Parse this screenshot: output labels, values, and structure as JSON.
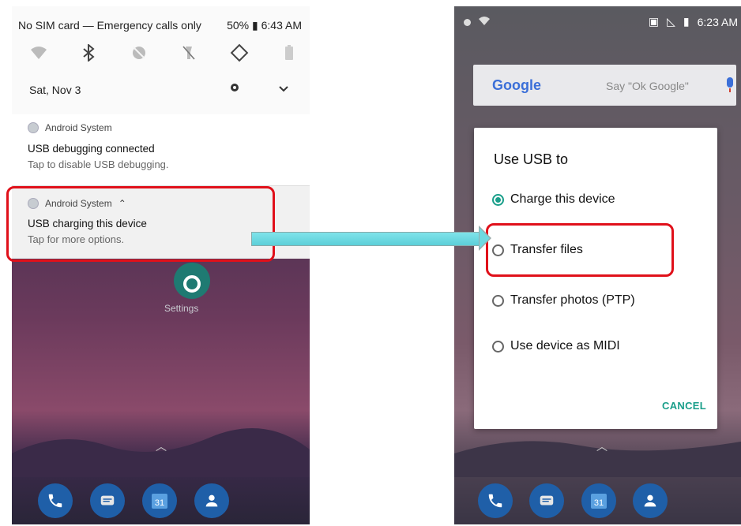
{
  "left_phone": {
    "status_text": "No SIM card — Emergency calls only",
    "battery": "50%",
    "time": "6:43 AM",
    "date": "Sat, Nov 3",
    "notification1": {
      "app": "Android System",
      "title": "USB debugging connected",
      "subtitle": "Tap to disable USB debugging."
    },
    "notification2": {
      "app": "Android System",
      "title": "USB charging this device",
      "subtitle": "Tap for more options."
    },
    "home_app_label": "Settings",
    "calendar_day": "31"
  },
  "right_phone": {
    "time": "6:23 AM",
    "search_brand": "Google",
    "search_hint": "Say \"Ok Google\"",
    "dialog": {
      "title": "Use USB to",
      "options": [
        {
          "label": "Charge this device",
          "selected": true
        },
        {
          "label": "Transfer files",
          "selected": false
        },
        {
          "label": "Transfer photos (PTP)",
          "selected": false
        },
        {
          "label": "Use device as MIDI",
          "selected": false
        }
      ],
      "cancel": "CANCEL"
    },
    "calendar_day": "31"
  },
  "colors": {
    "accent": "#199e8a",
    "highlight": "#e0101a",
    "arrow": "#6fd9e1"
  }
}
